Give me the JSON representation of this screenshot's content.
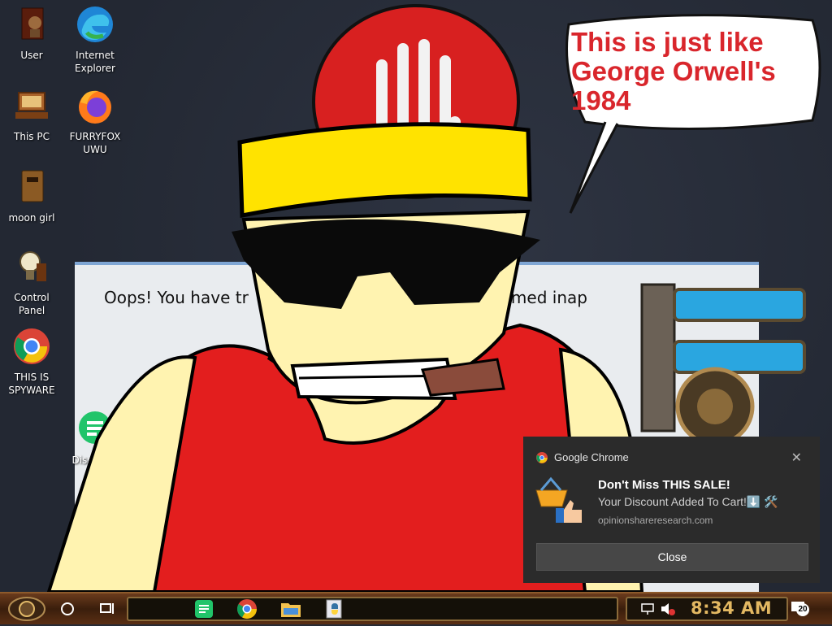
{
  "desktop_icons": [
    {
      "label": "User",
      "icon": "user-folder-icon"
    },
    {
      "label": "Internet Explorer",
      "icon": "edge-icon"
    },
    {
      "label": "This PC",
      "icon": "computer-icon"
    },
    {
      "label": "FURRYFOX UWU",
      "icon": "firefox-icon"
    },
    {
      "label": "moon girl",
      "icon": "folder-icon"
    },
    {
      "label": "Control Panel",
      "icon": "control-panel-icon"
    },
    {
      "label": "THIS IS SPYWARE",
      "icon": "chrome-icon"
    },
    {
      "label": "Dissenter",
      "icon": "dissenter-icon"
    }
  ],
  "dialog": {
    "text_left": "Oops! You have tr",
    "text_right": "s been deemed inap"
  },
  "speech_bubble": {
    "line1": "This is just like",
    "line2": "George Orwell's",
    "line3": "1984"
  },
  "toast": {
    "app_name": "Google Chrome",
    "title": "Don't Miss THIS SALE!",
    "body": "Your Discount Added To Cart!⬇️ 🛠️",
    "source": "opinionshareresearch.com",
    "close_label": "Close",
    "close_icon": "close-icon"
  },
  "taskbar": {
    "time": "8:34 AM",
    "notification_count": "20",
    "pinned": [
      "dissenter-icon",
      "chrome-icon",
      "file-explorer-icon",
      "python-icon"
    ]
  },
  "colors": {
    "bubble_text": "#d9262c",
    "clock": "#e3b862",
    "toast_bg": "#2b2b2b",
    "taskbar": "#4a2813"
  }
}
